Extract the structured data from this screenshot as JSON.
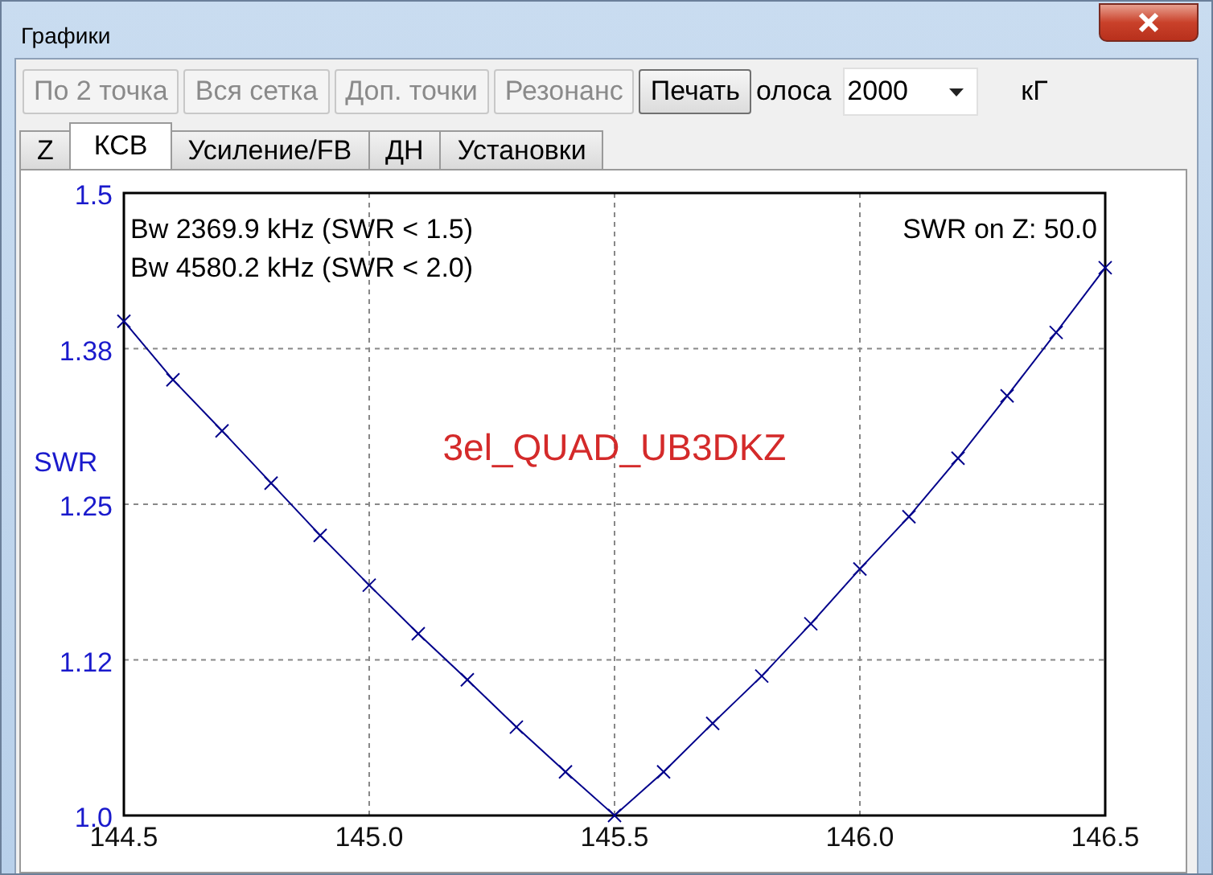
{
  "window": {
    "title": "Графики"
  },
  "toolbar": {
    "buttons": [
      {
        "label": "По 2 точка",
        "disabled": true
      },
      {
        "label": "Вся сетка",
        "disabled": true
      },
      {
        "label": "Доп. точки",
        "disabled": true
      },
      {
        "label": "Резонанс",
        "disabled": true
      },
      {
        "label": "Печать",
        "disabled": false
      }
    ],
    "band_label": "олоса",
    "band_value": "2000",
    "unit_label": "кГ"
  },
  "tabs": [
    {
      "label": "Z",
      "selected": false
    },
    {
      "label": "КСВ",
      "selected": true
    },
    {
      "label": "Усиление/FB",
      "selected": false
    },
    {
      "label": "ДН",
      "selected": false
    },
    {
      "label": "Установки",
      "selected": false
    }
  ],
  "chart": {
    "info_lines": [
      "Bw 2369.9 kHz (SWR < 1.5)",
      "Bw 4580.2 kHz (SWR < 2.0)"
    ],
    "reference": "SWR on Z: 50.0",
    "antenna_name": "3el_QUAD_UB3DKZ",
    "chart_data": {
      "type": "line",
      "ylabel": "SWR",
      "x": [
        144.5,
        144.6,
        144.7,
        144.8,
        144.9,
        145.0,
        145.1,
        145.2,
        145.3,
        145.4,
        145.5,
        145.6,
        145.7,
        145.8,
        145.9,
        146.0,
        146.1,
        146.2,
        146.3,
        146.4,
        146.5
      ],
      "grid": true,
      "series": [
        {
          "color": "#00008b",
          "marker": "x",
          "values": [
            1.397,
            1.35,
            1.309,
            1.267,
            1.225,
            1.185,
            1.146,
            1.109,
            1.071,
            1.035,
            1.0,
            1.035,
            1.074,
            1.112,
            1.154,
            1.198,
            1.24,
            1.287,
            1.337,
            1.388,
            1.44
          ]
        }
      ],
      "xlim": [
        144.5,
        146.5
      ],
      "ylim": [
        1.0,
        1.5
      ],
      "xticks": [
        {
          "value": 144.5,
          "label": "144.5"
        },
        {
          "value": 145.0,
          "label": "145.0"
        },
        {
          "value": 145.5,
          "label": "145.5"
        },
        {
          "value": 146.0,
          "label": "146.0"
        },
        {
          "value": 146.5,
          "label": "146.5"
        }
      ],
      "yticks": [
        {
          "value": 1.0,
          "label": "1.0"
        },
        {
          "value": 1.125,
          "label": "1.12"
        },
        {
          "value": 1.25,
          "label": "1.25"
        },
        {
          "value": 1.375,
          "label": "1.38"
        },
        {
          "value": 1.5,
          "label": "1.5"
        }
      ]
    }
  }
}
